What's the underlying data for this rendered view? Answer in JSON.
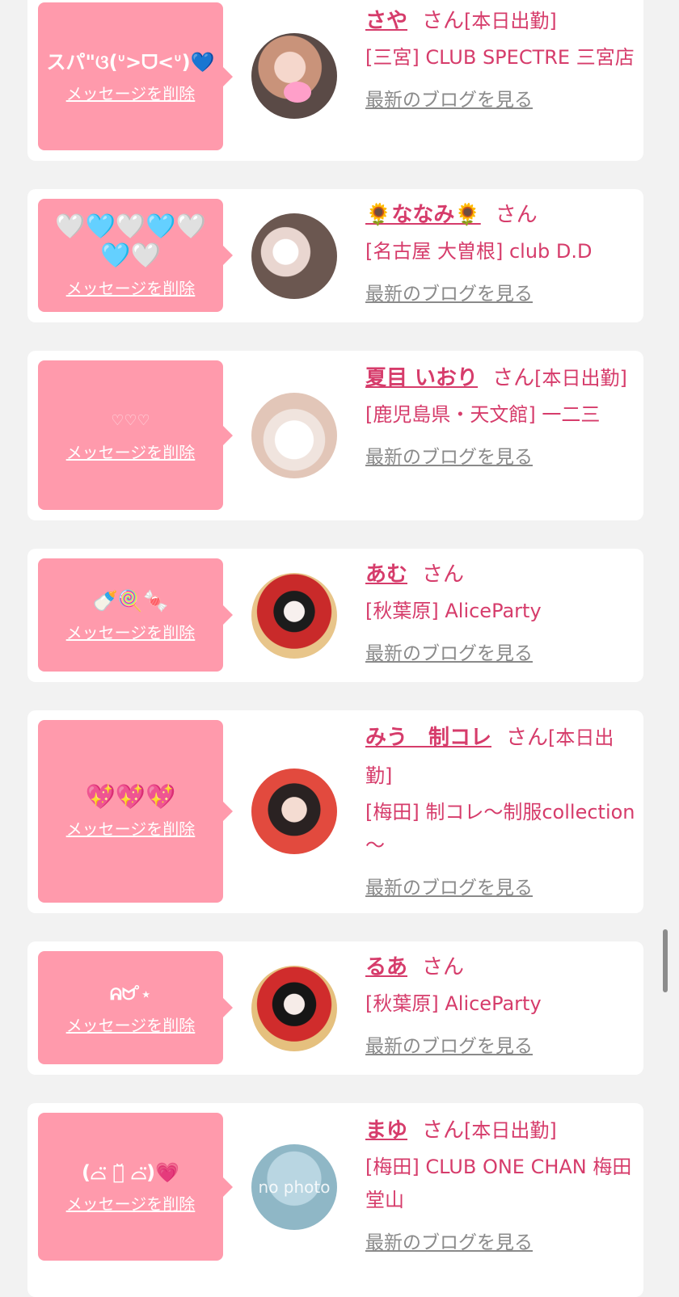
{
  "delete_label": "メッセージを削除",
  "blog_label": "最新のブログを見る",
  "san_label": "さん",
  "entries": [
    {
      "message": "スパ\"ଓ(ᐡ>ᗜ<ᐡ)💙",
      "name": "さや",
      "status": "[本日出勤]",
      "shop": "[三宮] CLUB SPECTRE 三宮店"
    },
    {
      "message": "🤍🩵🤍🩵🤍🩵🤍",
      "name": "🌻ななみ🌻",
      "status": "",
      "shop": "[名古屋 大曽根] club D.D"
    },
    {
      "message": "♡♡♡",
      "name": "夏目 いおり",
      "status": "[本日出勤]",
      "shop": "[鹿児島県・天文館] 一二三"
    },
    {
      "message": "🍼🍭🍬",
      "name": "あむ",
      "status": "",
      "shop": "[秋葉原] AliceParty"
    },
    {
      "message": "💖💖💖",
      "name": "みう　制コレ",
      "status": "[本日出勤]",
      "shop": "[梅田] 制コレ～制服collection～"
    },
    {
      "message": "ᕱᗢ ̊⋆",
      "name": "るあ",
      "status": "",
      "shop": "[秋葉原] AliceParty"
    },
    {
      "message": "(⌓̈ ･̆ ⌓̈)💗",
      "name": "まゆ",
      "status": "[本日出勤]",
      "shop": "[梅田] CLUB ONE CHAN 梅田堂山"
    }
  ],
  "no_photo_label": "no photo",
  "colors": {
    "accent": "#d63c6b",
    "bubble": "#ff9aac",
    "background": "#f2f2f2"
  }
}
